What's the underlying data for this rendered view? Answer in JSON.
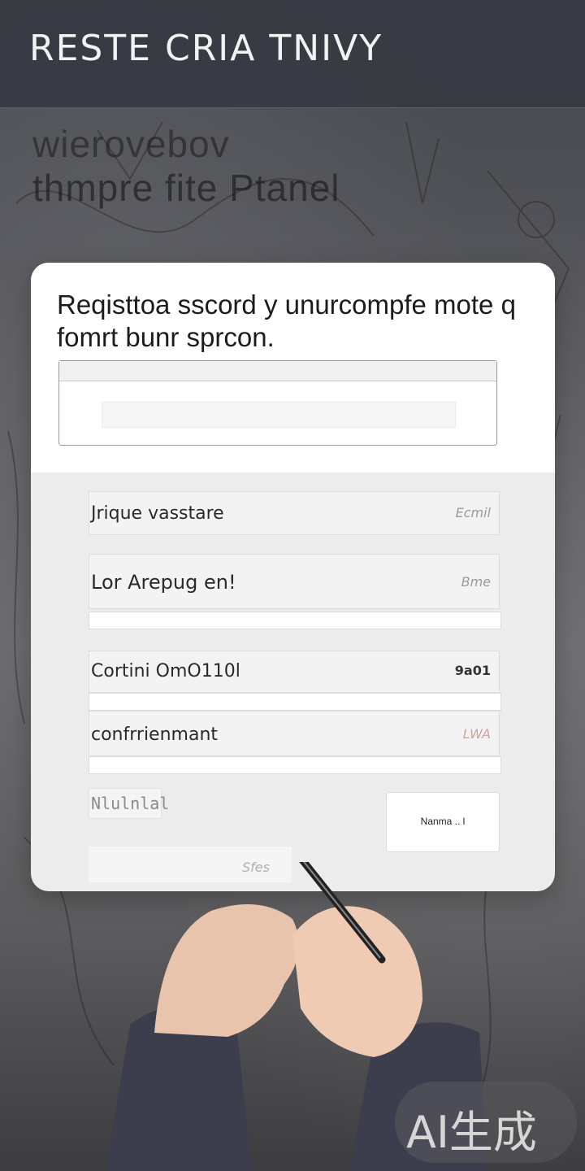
{
  "header": {
    "title": "RESTE CRIA TNIVY"
  },
  "background_text": {
    "line1": "wierovebov",
    "line2": "thmpre fite Ptanel"
  },
  "card": {
    "title": "Reqisttoa sscord y unurcompfe mote q fomrt  bunr  sprcon."
  },
  "fields": [
    {
      "label": "Jrique vasstare",
      "meta": "Ecmil"
    },
    {
      "label": "Lor Arepug en!",
      "meta": "Bme"
    },
    {
      "label": "Cortini OmO110l",
      "meta": "9a01"
    },
    {
      "label": "confrrienmant",
      "meta": "LWA"
    }
  ],
  "small_chip": {
    "label": "Nlulnlal"
  },
  "submit_button": {
    "label": "Nanma .. l"
  },
  "faint_text": "Sfes",
  "badge": {
    "text": "AI生成"
  },
  "colors": {
    "header_bg": "#373a42",
    "card_bg": "#ececec",
    "card_top_bg": "#ffffff",
    "text_dark": "#1c1c1c"
  }
}
